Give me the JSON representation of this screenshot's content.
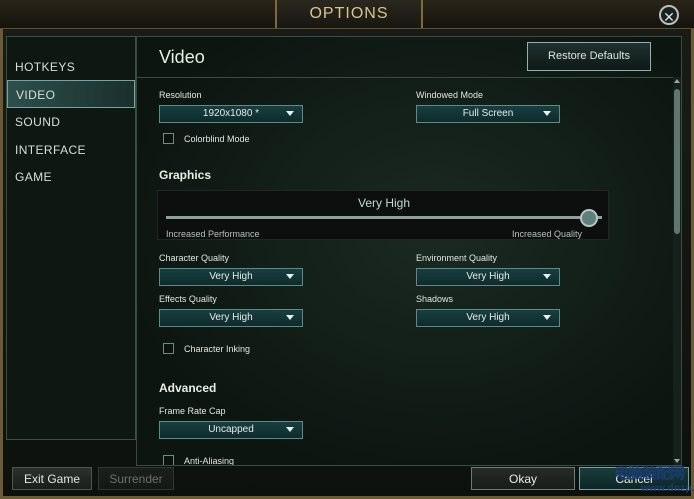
{
  "window": {
    "title": "OPTIONS",
    "close_icon": "close-icon"
  },
  "sidebar": {
    "items": [
      {
        "label": "HOTKEYS"
      },
      {
        "label": "VIDEO",
        "active": true
      },
      {
        "label": "SOUND"
      },
      {
        "label": "INTERFACE"
      },
      {
        "label": "GAME"
      }
    ]
  },
  "main": {
    "title": "Video",
    "restore_label": "Restore Defaults",
    "resolution": {
      "label": "Resolution",
      "value": "1920x1080 *"
    },
    "windowed_mode": {
      "label": "Windowed Mode",
      "value": "Full Screen"
    },
    "colorblind_label": "Colorblind Mode",
    "graphics": {
      "section": "Graphics",
      "slider": {
        "value_label": "Very High",
        "left_label": "Increased Performance",
        "right_label": "Increased Quality",
        "level_fraction": 1.0
      }
    },
    "character_quality": {
      "label": "Character Quality",
      "value": "Very High"
    },
    "environment_quality": {
      "label": "Environment Quality",
      "value": "Very High"
    },
    "effects_quality": {
      "label": "Effects Quality",
      "value": "Very High"
    },
    "shadows": {
      "label": "Shadows",
      "value": "Very High"
    },
    "character_inking_label": "Character Inking",
    "advanced": {
      "section": "Advanced",
      "frame_rate_cap": {
        "label": "Frame Rate Cap",
        "value": "Uncapped"
      },
      "anti_aliasing_label": "Anti-Aliasing"
    }
  },
  "footer": {
    "exit_label": "Exit Game",
    "surrender_label": "Surrender",
    "okay_label": "Okay",
    "cancel_label": "Cancel"
  },
  "watermark": {
    "line1": "电脑装配网",
    "line2": "www.dnzp.com"
  },
  "colors": {
    "accent": "#6ea8a2",
    "gold": "#d8c58b"
  }
}
